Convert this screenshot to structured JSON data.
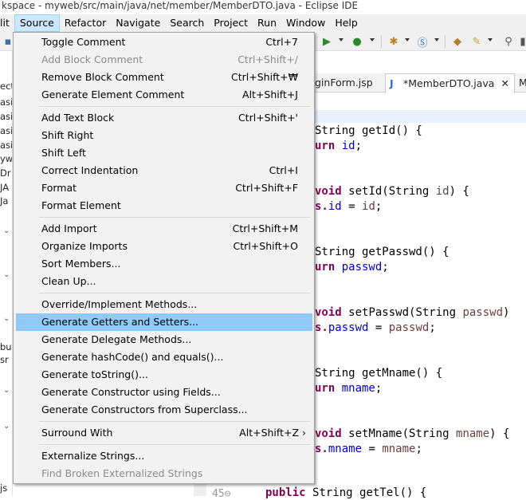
{
  "window": {
    "title": "kspace - myweb/src/main/java/net/member/MemberDTO.java - Eclipse IDE"
  },
  "menubar": [
    {
      "label": "lit",
      "active": false
    },
    {
      "label": "Source",
      "active": true
    },
    {
      "label": "Refactor",
      "active": false
    },
    {
      "label": "Navigate",
      "active": false
    },
    {
      "label": "Search",
      "active": false
    },
    {
      "label": "Project",
      "active": false
    },
    {
      "label": "Run",
      "active": false
    },
    {
      "label": "Window",
      "active": false
    },
    {
      "label": "Help",
      "active": false
    }
  ],
  "toolbar_icons": [
    "save-icon",
    "run-icon",
    "debug-icon",
    "new-class-icon",
    "new-java-icon",
    "open-type-icon",
    "open-task-icon",
    "perspective-icon"
  ],
  "left_panel": {
    "fragments": [
      "ect",
      "asic",
      "asic",
      "asic",
      "asic",
      "ywe",
      "Dr",
      "JA",
      "Ja",
      "bu",
      "sr",
      "js"
    ]
  },
  "editor": {
    "tabs": [
      {
        "label": "ginForm.jsp",
        "active": false
      },
      {
        "label": "*MemberDTO.java",
        "active": true,
        "close": "✕"
      },
      {
        "label": "M",
        "active": false
      }
    ],
    "code_lines": [
      {
        "parts": [
          {
            "t": "String getId() {",
            "c": ""
          }
        ]
      },
      {
        "parts": [
          {
            "t": "urn ",
            "c": "kw"
          },
          {
            "t": "id",
            "c": "fld"
          },
          {
            "t": ";",
            "c": ""
          }
        ]
      },
      {
        "parts": [
          {
            "t": "void ",
            "c": "kw"
          },
          {
            "t": "setId(String ",
            "c": ""
          },
          {
            "t": "id",
            "c": "prm"
          },
          {
            "t": ") {",
            "c": ""
          }
        ]
      },
      {
        "parts": [
          {
            "t": "s.",
            "c": "kw"
          },
          {
            "t": "id",
            "c": "fld"
          },
          {
            "t": " = ",
            "c": ""
          },
          {
            "t": "id",
            "c": "prm"
          },
          {
            "t": ";",
            "c": ""
          }
        ]
      },
      {
        "parts": [
          {
            "t": "String getPasswd() {",
            "c": ""
          }
        ]
      },
      {
        "parts": [
          {
            "t": "urn ",
            "c": "kw"
          },
          {
            "t": "passwd",
            "c": "fld"
          },
          {
            "t": ";",
            "c": ""
          }
        ]
      },
      {
        "parts": [
          {
            "t": "void ",
            "c": "kw"
          },
          {
            "t": "setPasswd(String ",
            "c": ""
          },
          {
            "t": "passwd",
            "c": "prm"
          },
          {
            "t": ")",
            "c": ""
          }
        ]
      },
      {
        "parts": [
          {
            "t": "s.",
            "c": "kw"
          },
          {
            "t": "passwd",
            "c": "fld"
          },
          {
            "t": " = ",
            "c": ""
          },
          {
            "t": "passwd",
            "c": "prm"
          },
          {
            "t": ";",
            "c": ""
          }
        ]
      },
      {
        "parts": [
          {
            "t": "String getMname() {",
            "c": ""
          }
        ]
      },
      {
        "parts": [
          {
            "t": "urn ",
            "c": "kw"
          },
          {
            "t": "mname",
            "c": "fld"
          },
          {
            "t": ";",
            "c": ""
          }
        ]
      },
      {
        "parts": [
          {
            "t": "void ",
            "c": "kw"
          },
          {
            "t": "setMname(String ",
            "c": ""
          },
          {
            "t": "mname",
            "c": "prm"
          },
          {
            "t": ") {",
            "c": ""
          }
        ]
      },
      {
        "parts": [
          {
            "t": "s.",
            "c": "kw"
          },
          {
            "t": "mname",
            "c": "fld"
          },
          {
            "t": " = ",
            "c": ""
          },
          {
            "t": "mname",
            "c": "prm"
          },
          {
            "t": ";",
            "c": ""
          }
        ]
      },
      {
        "parts": [
          {
            "t": "public ",
            "c": "kw"
          },
          {
            "t": "String getTel() {",
            "c": ""
          }
        ]
      }
    ],
    "line_number": "45⊖"
  },
  "source_menu": {
    "items": [
      {
        "label": "Toggle Comment",
        "accel": "Ctrl+7",
        "disabled": false
      },
      {
        "label": "Add Block Comment",
        "accel": "Ctrl+Shift+/",
        "disabled": true
      },
      {
        "label": "Remove Block Comment",
        "accel": "Ctrl+Shift+₩",
        "disabled": false
      },
      {
        "label": "Generate Element Comment",
        "accel": "Alt+Shift+J",
        "disabled": false
      },
      {
        "sep": true
      },
      {
        "label": "Add Text Block",
        "accel": "Ctrl+Shift+'",
        "disabled": false
      },
      {
        "label": "Shift Right",
        "accel": "",
        "disabled": false
      },
      {
        "label": "Shift Left",
        "accel": "",
        "disabled": false
      },
      {
        "label": "Correct Indentation",
        "accel": "Ctrl+I",
        "disabled": false
      },
      {
        "label": "Format",
        "accel": "Ctrl+Shift+F",
        "disabled": false
      },
      {
        "label": "Format Element",
        "accel": "",
        "disabled": false
      },
      {
        "sep": true
      },
      {
        "label": "Add Import",
        "accel": "Ctrl+Shift+M",
        "disabled": false
      },
      {
        "label": "Organize Imports",
        "accel": "Ctrl+Shift+O",
        "disabled": false
      },
      {
        "label": "Sort Members...",
        "accel": "",
        "disabled": false
      },
      {
        "label": "Clean Up...",
        "accel": "",
        "disabled": false
      },
      {
        "sep": true
      },
      {
        "label": "Override/Implement Methods...",
        "accel": "",
        "disabled": false
      },
      {
        "label": "Generate Getters and Setters...",
        "accel": "",
        "disabled": false,
        "hover": true
      },
      {
        "label": "Generate Delegate Methods...",
        "accel": "",
        "disabled": false
      },
      {
        "label": "Generate hashCode() and equals()...",
        "accel": "",
        "disabled": false
      },
      {
        "label": "Generate toString()...",
        "accel": "",
        "disabled": false
      },
      {
        "label": "Generate Constructor using Fields...",
        "accel": "",
        "disabled": false
      },
      {
        "label": "Generate Constructors from Superclass...",
        "accel": "",
        "disabled": false
      },
      {
        "sep": true
      },
      {
        "label": "Surround With",
        "accel": "Alt+Shift+Z ›",
        "disabled": false,
        "submenu": true
      },
      {
        "sep": true
      },
      {
        "label": "Externalize Strings...",
        "accel": "",
        "disabled": false
      },
      {
        "label": "Find Broken Externalized Strings",
        "accel": "",
        "disabled": true
      }
    ]
  },
  "colors": {
    "menu_bg": "#f2f2f2",
    "hover_bg": "#91c9f7",
    "keyword": "#7f0055",
    "field": "#0000c0"
  }
}
